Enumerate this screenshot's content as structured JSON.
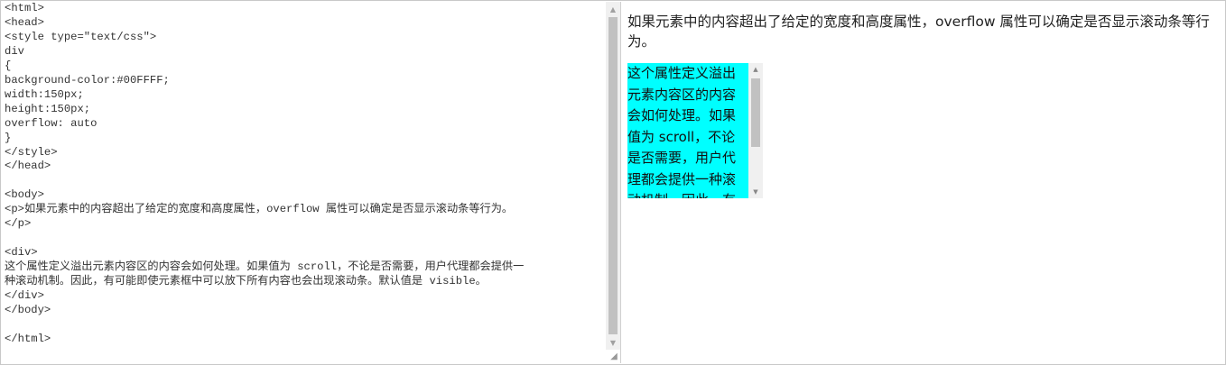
{
  "editor": {
    "lines": [
      "<html>",
      "<head>",
      "<style type=\"text/css\">",
      "div",
      "{",
      "background-color:#00FFFF;",
      "width:150px;",
      "height:150px;",
      "overflow: auto",
      "}",
      "</style>",
      "</head>",
      "",
      "<body>",
      "<p>如果元素中的内容超出了给定的宽度和高度属性，overflow 属性可以确定是否显示滚动条等行为。",
      "</p>",
      "",
      "<div>",
      "这个属性定义溢出元素内容区的内容会如何处理。如果值为 scroll，不论是否需要，用户代理都会提供一",
      "种滚动机制。因此，有可能即使元素框中可以放下所有内容也会出现滚动条。默认值是 visible。",
      "</div>",
      "</body>",
      "",
      "</html>"
    ],
    "scroll_up_icon": "triangle-up",
    "scroll_down_icon": "triangle-down",
    "resize_icon": "resize-grip"
  },
  "preview": {
    "paragraph": "如果元素中的内容超出了给定的宽度和高度属性，overflow 属性可以确定是否显示滚动条等行为。",
    "box_text": "这个属性定义溢出元素内容区的内容会如何处理。如果值为 scroll，不论是否需要，用户代理都会提供一种滚动机制。因此，有可能即使元素框中可以放下所有内容也会出现滚动条。默认值是 visible。",
    "box_color": "#00FFFF"
  }
}
